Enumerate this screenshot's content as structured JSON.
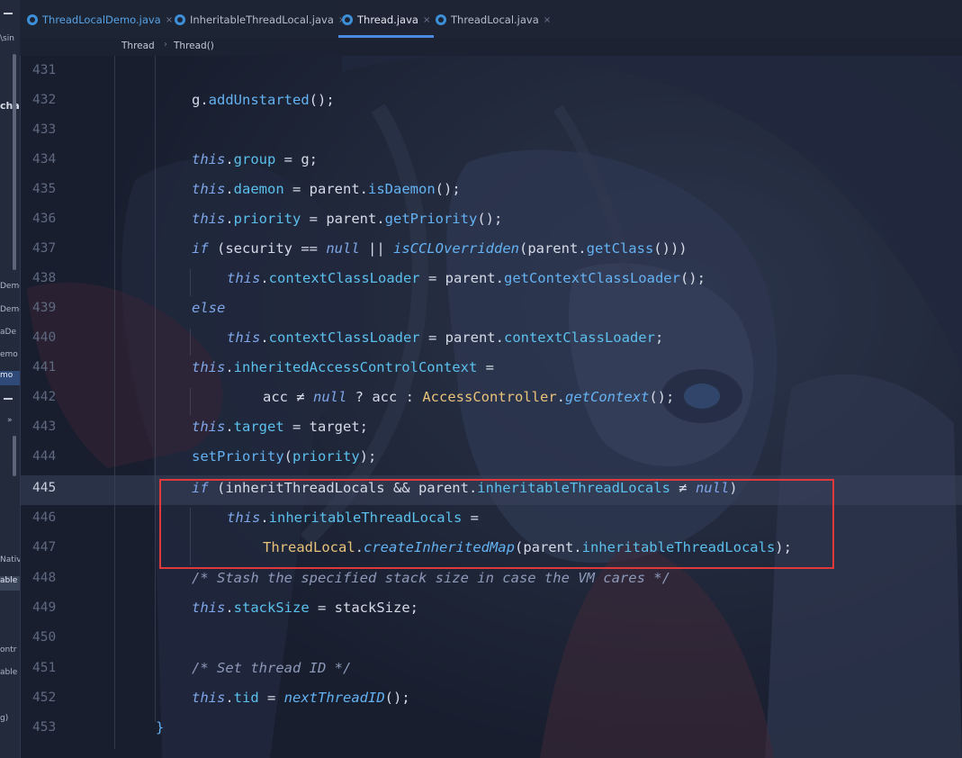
{
  "tabs": [
    {
      "label": "ThreadLocalDemo.java",
      "close": "×"
    },
    {
      "label": "InheritableThreadLocal.java",
      "close": "×"
    },
    {
      "label": "Thread.java",
      "close": "×",
      "active": true
    },
    {
      "label": "ThreadLocal.java",
      "close": "×"
    }
  ],
  "breadcrumb": [
    "Thread",
    "Thread()"
  ],
  "left_panel": {
    "items": [
      "\\sin",
      "cha",
      "Demo",
      "Demo",
      "aDe",
      "emo",
      "mo",
      "»",
      "Native",
      "able",
      "ontr",
      "able",
      "g)"
    ]
  },
  "code": {
    "lines": [
      {
        "n": "431"
      },
      {
        "n": "432"
      },
      {
        "n": "433"
      },
      {
        "n": "434"
      },
      {
        "n": "435"
      },
      {
        "n": "436"
      },
      {
        "n": "437"
      },
      {
        "n": "438"
      },
      {
        "n": "439"
      },
      {
        "n": "440"
      },
      {
        "n": "441"
      },
      {
        "n": "442"
      },
      {
        "n": "443"
      },
      {
        "n": "444"
      },
      {
        "n": "445"
      },
      {
        "n": "446"
      },
      {
        "n": "447"
      },
      {
        "n": "448"
      },
      {
        "n": "449"
      },
      {
        "n": "450"
      },
      {
        "n": "451"
      },
      {
        "n": "452"
      },
      {
        "n": "453"
      }
    ],
    "tokens": {
      "l432": [
        "g.",
        "addUnstarted",
        "();"
      ],
      "l434": [
        "this",
        ".",
        "group",
        " = g;"
      ],
      "l435": [
        "this",
        ".",
        "daemon",
        " = parent.",
        "isDaemon",
        "();"
      ],
      "l436": [
        "this",
        ".",
        "priority",
        " = parent.",
        "getPriority",
        "();"
      ],
      "l437": [
        "if",
        " (security ",
        "==",
        " ",
        "null",
        " || ",
        "isCCLOverridden",
        "(parent.",
        "getClass",
        "()))"
      ],
      "l438": [
        "this",
        ".",
        "contextClassLoader",
        " = parent.",
        "getContextClassLoader",
        "();"
      ],
      "l439": [
        "else"
      ],
      "l440": [
        "this",
        ".",
        "contextClassLoader",
        " = parent.",
        "contextClassLoader",
        ";"
      ],
      "l441": [
        "this",
        ".",
        "inheritedAccessControlContext",
        " ="
      ],
      "l442": [
        "acc ",
        "≠",
        " ",
        "null",
        " ? acc : ",
        "AccessController",
        ".",
        "getContext",
        "();"
      ],
      "l443": [
        "this",
        ".",
        "target",
        " = target;"
      ],
      "l444": [
        "setPriority",
        "(",
        "priority",
        ");"
      ],
      "l445": [
        "if",
        " (inheritThreadLocals && parent.",
        "inheritableThreadLocals",
        " ",
        "≠",
        " ",
        "null",
        ")"
      ],
      "l446": [
        "this",
        ".",
        "inheritableThreadLocals",
        " ="
      ],
      "l447": [
        "ThreadLocal",
        ".",
        "createInheritedMap",
        "(parent.",
        "inheritableThreadLocals",
        ");"
      ],
      "l448": [
        "/* Stash the specified stack size in case the VM cares */"
      ],
      "l449": [
        "this",
        ".",
        "stackSize",
        " = stackSize;"
      ],
      "l451": [
        "/* Set thread ID */"
      ],
      "l452": [
        "this",
        ".",
        "tid",
        " = ",
        "nextThreadID",
        "();"
      ],
      "l453": [
        "}"
      ]
    }
  },
  "colors": {
    "keyword": "#7fa6e8",
    "field": "#5bc0ec",
    "method": "#64b2f2",
    "class": "#e9c27a",
    "comment": "#8d99b8",
    "highlight_box": "#e0393b",
    "tab_underline": "#4a8ae0"
  },
  "highlight": {
    "from_line": "445",
    "to_line": "447"
  }
}
